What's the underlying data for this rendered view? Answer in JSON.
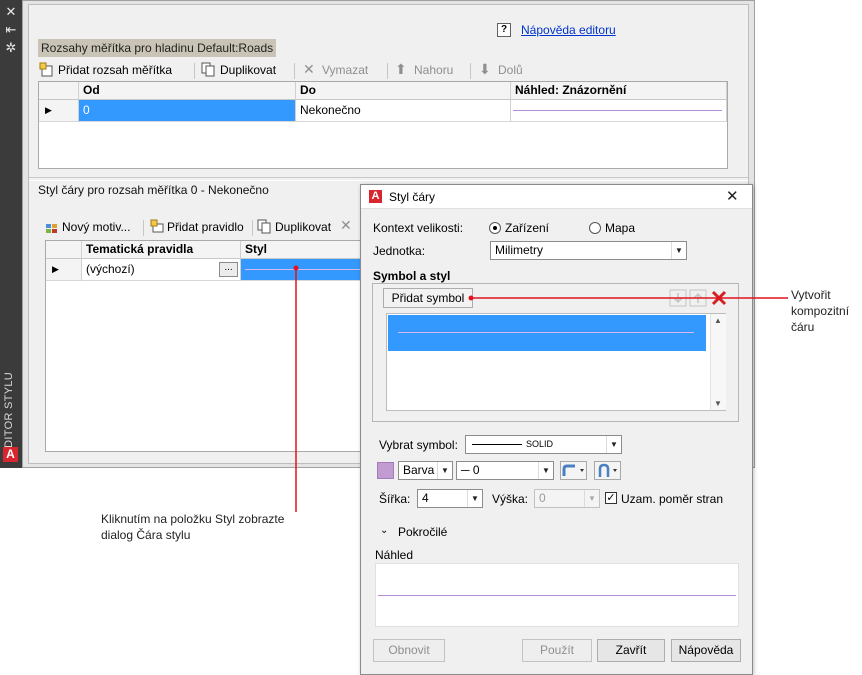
{
  "sidebar": {
    "title": "EDITOR STYLU",
    "icons": [
      "close-icon",
      "pin-icon",
      "settings-icon",
      "autocad-logo-icon"
    ],
    "glyphs": {
      "close": "✕",
      "pin": "⇤",
      "settings": "✲",
      "logo": "A"
    }
  },
  "editor": {
    "help_link": "Nápověda editoru",
    "help_icon": "?",
    "scale_ranges": {
      "title": "Rozsahy měřítka pro hladinu Default:Roads",
      "toolbar": {
        "add": "Přidat rozsah měřítka",
        "duplicate": "Duplikovat",
        "delete": "Vymazat",
        "up": "Nahoru",
        "down": "Dolů"
      },
      "columns": [
        "Od",
        "Do",
        "Náhled: Znázornění"
      ],
      "rows": [
        {
          "from": "0",
          "to": "Nekonečno"
        }
      ],
      "preview_color": "#b48fd6"
    },
    "line_style": {
      "title": "Styl čáry pro rozsah měřítka 0 - Nekonečno",
      "toolbar": {
        "new_theme": "Nový motiv...",
        "add_rule": "Přidat pravidlo",
        "duplicate": "Duplikovat"
      },
      "columns": [
        "Tematická pravidla",
        "Styl"
      ],
      "rows": [
        {
          "rule": "(výchozí)",
          "ellipsis": "..."
        }
      ]
    }
  },
  "dialog": {
    "title": "Styl čáry",
    "close_glyph": "✕",
    "size_context_label": "Kontext velikosti:",
    "size_context_options": [
      "Zařízení",
      "Mapa"
    ],
    "size_context_selected": "Zařízení",
    "unit_label": "Jednotka:",
    "unit_value": "Milimetry",
    "symbol_section": "Symbol a styl",
    "add_symbol": "Přidat symbol",
    "select_symbol_label": "Vybrat symbol:",
    "select_symbol_value": "SOLID",
    "color_label": "Barva",
    "color_value": "#c39bd3",
    "thickness_value": "─ 0",
    "width_label": "Šířka:",
    "width_value": "4",
    "height_label": "Výška:",
    "height_value": "0",
    "aspect_label": "Uzam. poměr stran",
    "aspect_checked": true,
    "advanced_label": "Pokročilé",
    "preview_label": "Náhled",
    "buttons": {
      "refresh": "Obnovit",
      "apply": "Použít",
      "close": "Zavřít",
      "help": "Nápověda"
    }
  },
  "callouts": {
    "composite": "Vytvořit kompozitní čáru",
    "style_hint": "Kliknutím na položku Styl zobrazte dialog Čára stylu",
    "line_color": "#e0141e"
  }
}
